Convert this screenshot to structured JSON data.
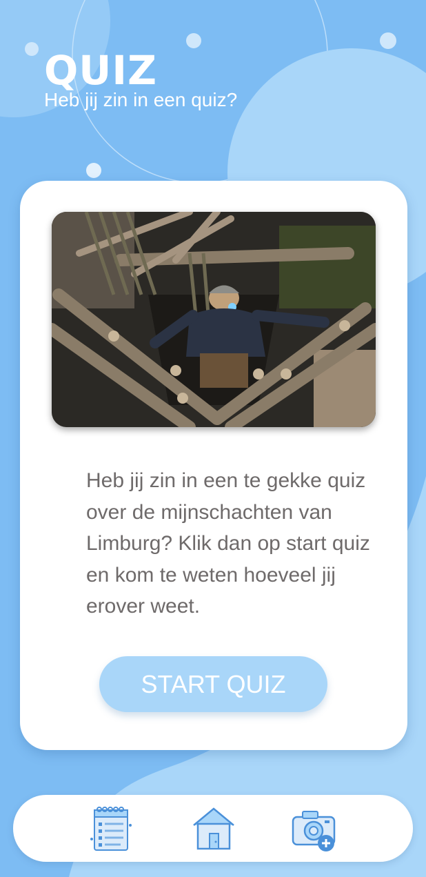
{
  "header": {
    "title": "QUIZ",
    "subtitle": "Heb jij zin in een quiz?"
  },
  "card": {
    "image_subject": "mine-shaft-photo",
    "description": "Heb jij zin in een te gekke quiz over de mijnschachten van Limburg? Klik dan op start quiz en kom te weten hoeveel jij erover weet.",
    "start_button_label": "START QUIZ"
  },
  "navbar": {
    "items": [
      {
        "icon": "notepad-list-icon"
      },
      {
        "icon": "home-icon"
      },
      {
        "icon": "camera-add-icon"
      }
    ]
  },
  "colors": {
    "background": "#7dbcf3",
    "light_blue": "#a9d6f9",
    "card": "#ffffff",
    "text": "#6e6a6a",
    "icon_blue": "#4a90d9"
  }
}
